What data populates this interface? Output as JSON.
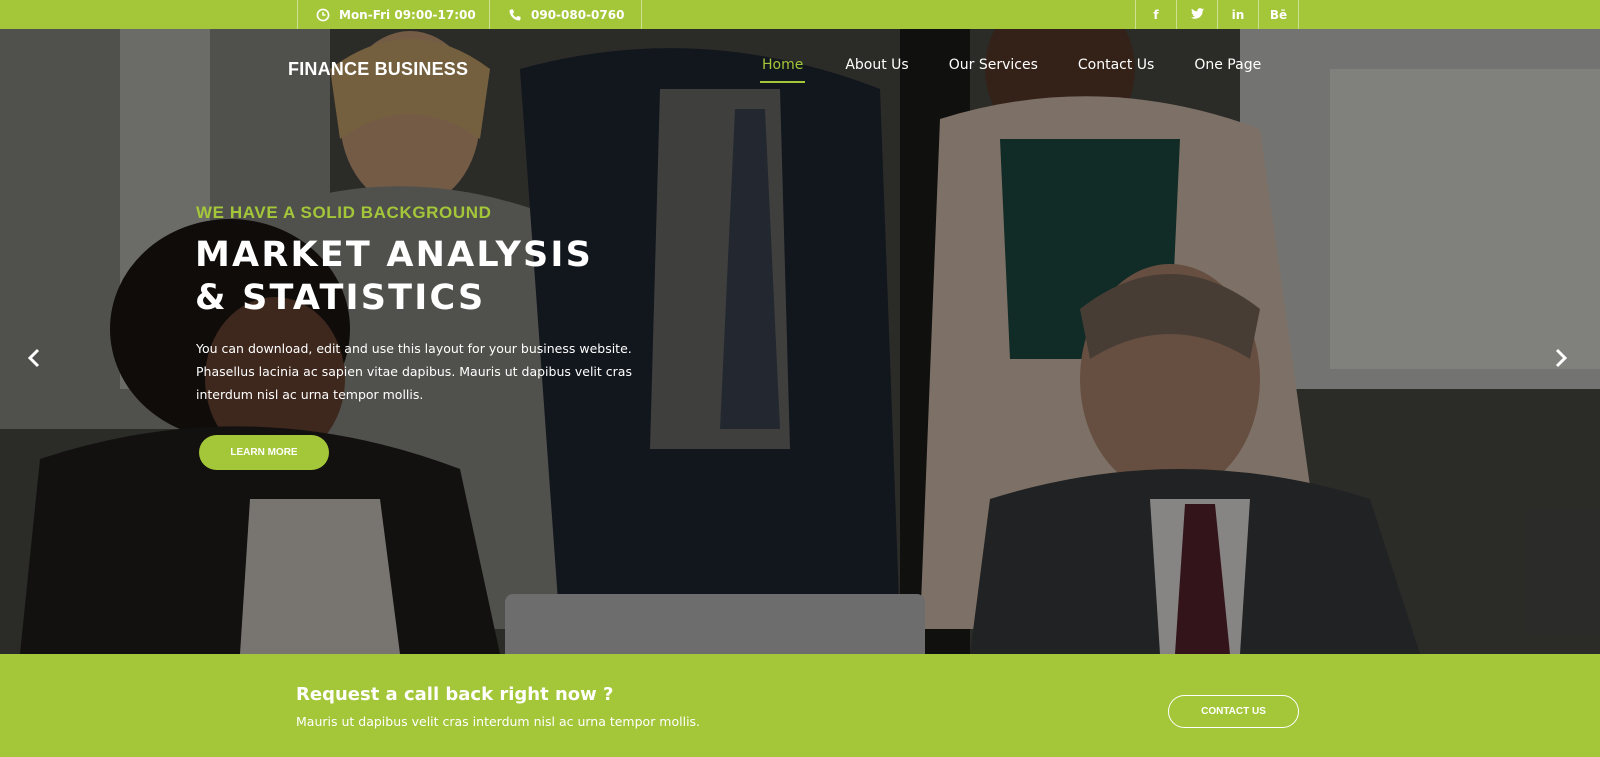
{
  "colors": {
    "accent": "#a4c639",
    "text": "#ffffff"
  },
  "topbar": {
    "hours": {
      "icon": "clock-icon",
      "text": "Mon-Fri 09:00-17:00"
    },
    "phone": {
      "icon": "phone-icon",
      "text": "090-080-0760"
    },
    "social": [
      {
        "icon": "facebook-icon",
        "label": "f"
      },
      {
        "icon": "twitter-icon",
        "label": ""
      },
      {
        "icon": "linkedin-icon",
        "label": "in"
      },
      {
        "icon": "behance-icon",
        "label": "Bē"
      }
    ]
  },
  "header": {
    "brand": "FINANCE BUSINESS",
    "nav": [
      {
        "label": "Home",
        "active": true
      },
      {
        "label": "About Us",
        "active": false
      },
      {
        "label": "Our Services",
        "active": false
      },
      {
        "label": "Contact Us",
        "active": false
      },
      {
        "label": "One Page",
        "active": false
      }
    ]
  },
  "hero": {
    "eyebrow": "WE HAVE A SOLID BACKGROUND",
    "headline_lines": [
      "MARKET ANALYSIS",
      "& STATISTICS"
    ],
    "lead_lines": [
      "You can download, edit and use this layout for your business website.",
      "Phasellus lacinia ac sapien vitae dapibus. Mauris ut dapibus velit cras",
      "interdum nisl ac urna tempor mollis."
    ],
    "button": "LEARN MORE",
    "prev_icon": "chevron-left-icon",
    "next_icon": "chevron-right-icon"
  },
  "callback": {
    "title": "Request a call back right now ?",
    "subtitle": "Mauris ut dapibus velit cras interdum nisl ac urna tempor mollis.",
    "button": "CONTACT US"
  }
}
